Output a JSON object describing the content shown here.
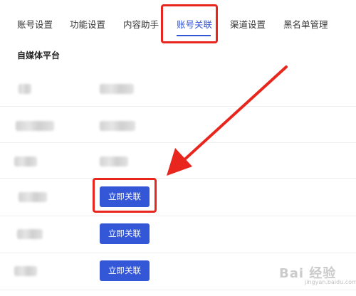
{
  "tabs": [
    {
      "label": "账号设置",
      "active": false
    },
    {
      "label": "功能设置",
      "active": false
    },
    {
      "label": "内容助手",
      "active": false
    },
    {
      "label": "账号关联",
      "active": true
    },
    {
      "label": "渠道设置",
      "active": false
    },
    {
      "label": "黑名单管理",
      "active": false
    }
  ],
  "section": {
    "title": "自媒体平台"
  },
  "rows": [
    {
      "platform_blurred": true,
      "status_blurred": true,
      "button": null
    },
    {
      "platform_blurred": true,
      "status_blurred": true,
      "button": null
    },
    {
      "platform_blurred": true,
      "status_blurred": true,
      "button": null
    },
    {
      "platform_blurred": true,
      "status_blurred": false,
      "button": "立即关联"
    },
    {
      "platform_blurred": true,
      "status_blurred": false,
      "button": "立即关联"
    },
    {
      "platform_blurred": true,
      "status_blurred": false,
      "button": "立即关联"
    }
  ],
  "watermark": {
    "text": "Bai 经验",
    "sub": "jingyan.baidu.com"
  },
  "colors": {
    "accent": "#3356d6",
    "highlight": "#e8261d",
    "button": "#3357d6"
  }
}
